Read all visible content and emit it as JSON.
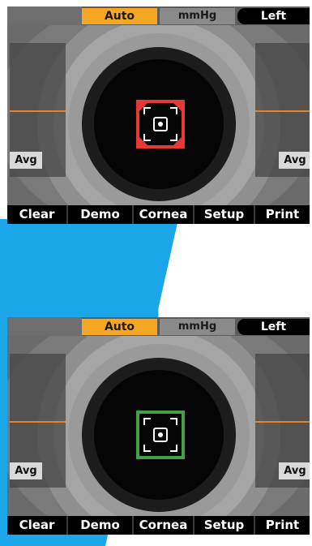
{
  "colors": {
    "accent_blue": "#1aa6e8",
    "mode_orange": "#f5a623",
    "align_red": "#e53935",
    "align_green": "#43a047",
    "marker_orange": "#e8822a"
  },
  "screens": [
    {
      "state": "misaligned",
      "status": {
        "mode": "Auto",
        "unit": "mmHg",
        "eye": "Left"
      },
      "panels": {
        "left_label": "Avg",
        "right_label": "Avg"
      },
      "target_color": "red",
      "toolbar": [
        "Clear",
        "Demo",
        "Cornea",
        "Setup",
        "Print"
      ]
    },
    {
      "state": "aligned",
      "status": {
        "mode": "Auto",
        "unit": "mmHg",
        "eye": "Left"
      },
      "panels": {
        "left_label": "Avg",
        "right_label": "Avg"
      },
      "target_color": "green",
      "toolbar": [
        "Clear",
        "Demo",
        "Cornea",
        "Setup",
        "Print"
      ]
    }
  ]
}
